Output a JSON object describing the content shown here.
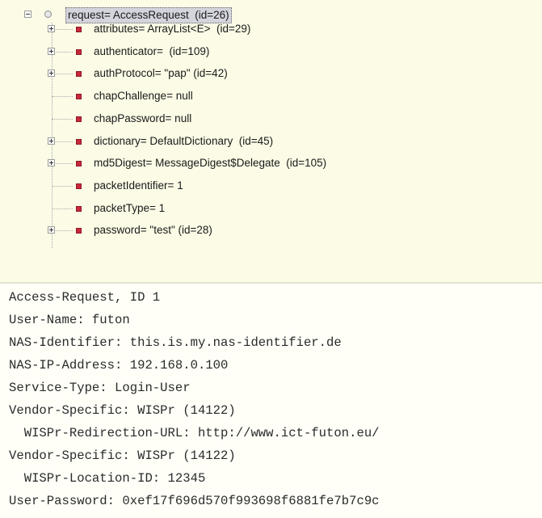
{
  "tree": {
    "root": {
      "label": "request= AccessRequest  (id=26)",
      "expanded": true,
      "selected": true
    },
    "children": [
      {
        "label": "attributes= ArrayList<E>  (id=29)",
        "expandable": true
      },
      {
        "label": "authenticator=  (id=109)",
        "expandable": true
      },
      {
        "label": "authProtocol= \"pap\" (id=42)",
        "expandable": true
      },
      {
        "label": "chapChallenge= null",
        "expandable": false
      },
      {
        "label": "chapPassword= null",
        "expandable": false
      },
      {
        "label": "dictionary= DefaultDictionary  (id=45)",
        "expandable": true
      },
      {
        "label": "md5Digest= MessageDigest$Delegate  (id=105)",
        "expandable": true
      },
      {
        "label": "packetIdentifier= 1",
        "expandable": false
      },
      {
        "label": "packetType= 1",
        "expandable": false
      },
      {
        "label": "password= \"test\" (id=28)",
        "expandable": true
      }
    ]
  },
  "console": {
    "lines": [
      "Access-Request, ID 1",
      "User-Name: futon",
      "NAS-Identifier: this.is.my.nas-identifier.de",
      "NAS-IP-Address: 192.168.0.100",
      "Service-Type: Login-User",
      "Vendor-Specific: WISPr (14122)",
      "  WISPr-Redirection-URL: http://www.ict-futon.eu/",
      "Vendor-Specific: WISPr (14122)",
      "  WISPr-Location-ID: 12345",
      "User-Password: 0xef17f696d570f993698f6881fe7b7c9c"
    ]
  },
  "colors": {
    "tree_background": "#fbfbe6",
    "console_background": "#fffff8",
    "field_icon": "#c8283a",
    "selection": "#d4d4dc"
  }
}
